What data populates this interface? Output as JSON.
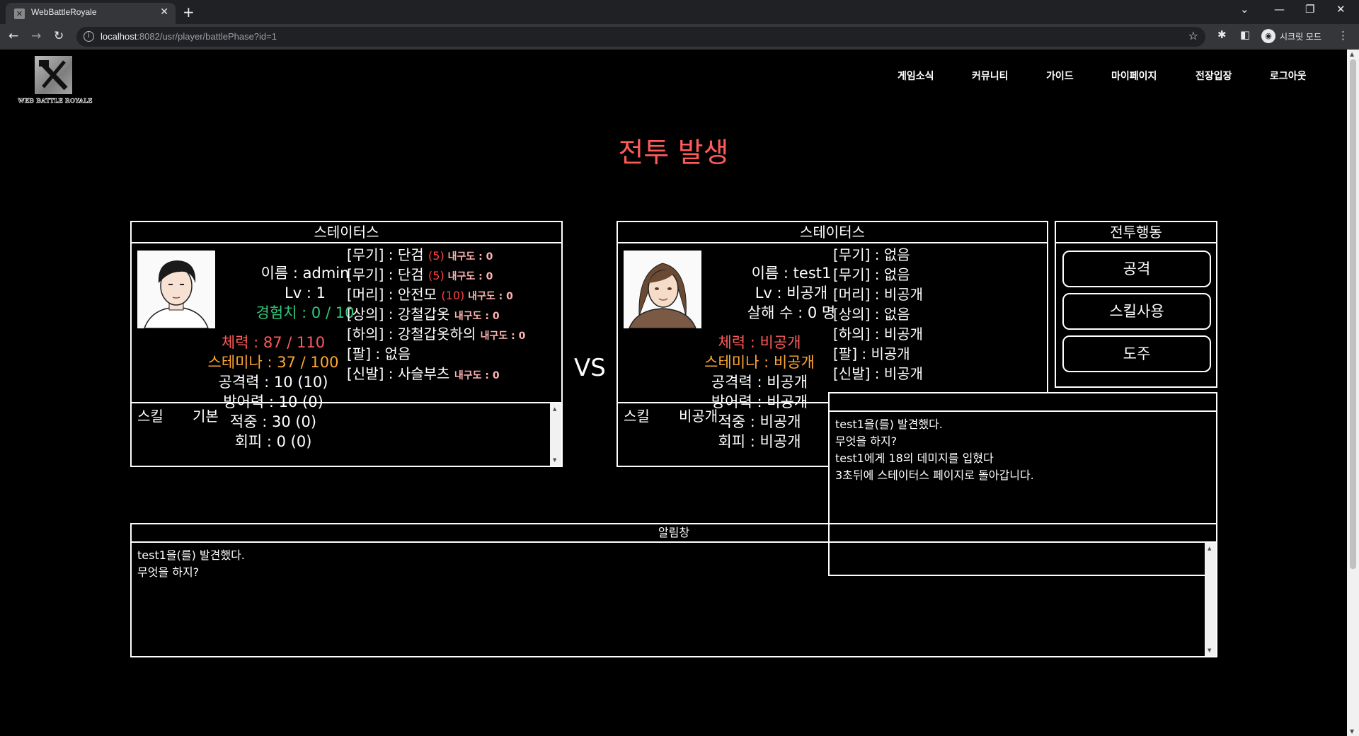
{
  "browser": {
    "tab_title": "WebBattleRoyale",
    "url_host": "localhost",
    "url_rest": ":8082/usr/player/battlePhase?id=1",
    "incognito_label": "시크릿 모드"
  },
  "site": {
    "logo_text": "WEB BATTLE ROYALE",
    "nav": [
      "게임소식",
      "커뮤니티",
      "가이드",
      "마이페이지",
      "전장입장",
      "로그아웃"
    ]
  },
  "battle_title": "전투 발생",
  "vs": "VS",
  "player": {
    "header": "스테이터스",
    "name": "이름 : admin",
    "level": "Lv : 1",
    "exp": "경험치 : 0 / 10",
    "hp": "체력 : 87 / 110",
    "stamina": "스테미나 : 37 / 100",
    "attack": "공격력 : 10 (10)",
    "defense": "방어력 : 10 (0)",
    "accuracy": "적중 : 30 (0)",
    "evasion": "회피 : 0 (0)",
    "equipment": [
      {
        "label": "[무기] : 단검 ",
        "bonus": "(5)",
        "durability": " 내구도 : 0"
      },
      {
        "label": "[무기] : 단검 ",
        "bonus": "(5)",
        "durability": " 내구도 : 0"
      },
      {
        "label": "[머리] : 안전모 ",
        "bonus": "(10)",
        "durability": " 내구도 : 0"
      },
      {
        "label": "[상의] : 강철갑옷 ",
        "bonus": "",
        "durability": " 내구도 : 0"
      },
      {
        "label": "[하의] : 강철갑옷하의 ",
        "bonus": "",
        "durability": " 내구도 : 0"
      },
      {
        "label": "[팔] : 없음",
        "bonus": "",
        "durability": ""
      },
      {
        "label": "[신발] : 사슬부츠 ",
        "bonus": "",
        "durability": " 내구도 : 0"
      }
    ],
    "skill_label": "스킬",
    "skill_value": "기본"
  },
  "enemy": {
    "header": "스테이터스",
    "name": "이름 : test1",
    "level": "Lv : 비공개",
    "kills": "살해 수 : 0 명",
    "hp": "체력 : 비공개",
    "stamina": "스테미나 : 비공개",
    "attack": "공격력 : 비공개",
    "defense": "방어력 : 비공개",
    "accuracy": "적중 : 비공개",
    "evasion": "회피 : 비공개",
    "equipment": [
      "[무기] : 없음",
      "[무기] : 없음",
      "[머리] : 비공개",
      "[상의] : 없음",
      "[하의] : 비공개",
      "[팔] : 비공개",
      "[신발] : 비공개"
    ],
    "skill_label": "스킬",
    "skill_value": "비공개"
  },
  "actions": {
    "header": "전투행동",
    "buttons": [
      "공격",
      "스킬사용",
      "도주"
    ]
  },
  "battle_log": [
    "test1을(를) 발견했다.",
    "무엇을 하지?",
    "test1에게 18의 데미지를 입혔다",
    "3초뒤에 스테이터스 페이지로 돌아갑니다."
  ],
  "alert": {
    "header": "알림창",
    "lines": [
      "test1을(를) 발견했다.",
      "무엇을 하지?"
    ]
  }
}
